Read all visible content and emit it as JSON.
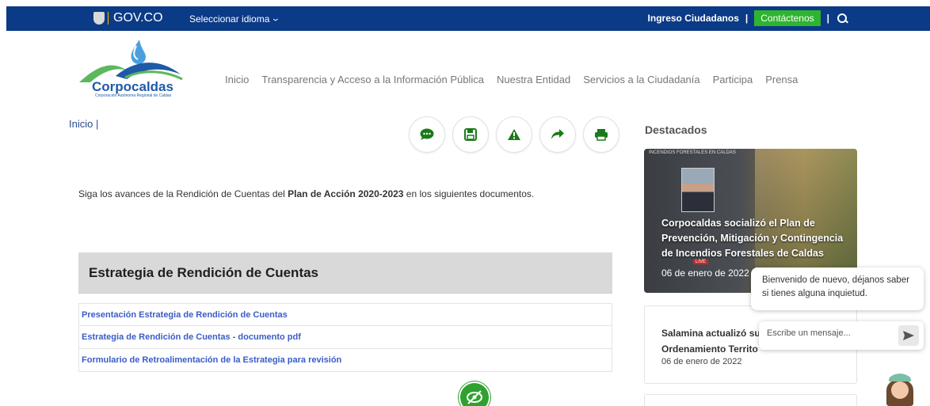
{
  "topbar": {
    "gov_label": "GOV.CO",
    "language_label": "Seleccionar idioma",
    "ingreso_label": "Ingreso Ciudadanos",
    "separator": "|",
    "contact_label": "Contáctenos",
    "colors": {
      "bar": "#0b3a86",
      "contact": "#2fb42f"
    }
  },
  "header": {
    "logo_name": "Corpocaldas",
    "logo_subtitle": "Corporación Autónoma Regional de Caldas",
    "nav": [
      "Inicio",
      "Transparencia y Acceso a la Información Pública",
      "Nuestra Entidad",
      "Servicios a la Ciudadanía",
      "Participa",
      "Prensa"
    ]
  },
  "breadcrumb": "Inicio |",
  "actions": [
    "comment-icon",
    "save-icon",
    "warning-icon",
    "share-icon",
    "print-icon"
  ],
  "intro": {
    "before": "Siga los avances de la Rendición de Cuentas del ",
    "bold": "Plan de Acción 2020-2023",
    "after": " en los siguientes documentos."
  },
  "section": {
    "title": "Estrategia de Rendición de Cuentas",
    "documents": [
      "Presentación Estrategia de Rendición de Cuentas",
      "Estrategia de Rendición de Cuentas - documento pdf",
      "Formulario de Retroalimentación de la Estrategia para revisión"
    ]
  },
  "sidebar": {
    "title": "Destacados",
    "featured": {
      "tag": "INCENDIOS FORESTALES EN CALDAS",
      "headline": "Corpocaldas socializó el Plan de Prevención, Mitigación y Contingencia de Incendios Forestales de Caldas",
      "live": "LIVE",
      "date": "06 de enero de 2022"
    },
    "card2": {
      "title": "Salamina actualizó su Ordenamiento Territo",
      "date": "06 de enero de 2022"
    }
  },
  "chat": {
    "message": "Bienvenido de nuevo, déjanos saber si tienes alguna inquietud.",
    "placeholder": "Escribe un mensaje..."
  }
}
